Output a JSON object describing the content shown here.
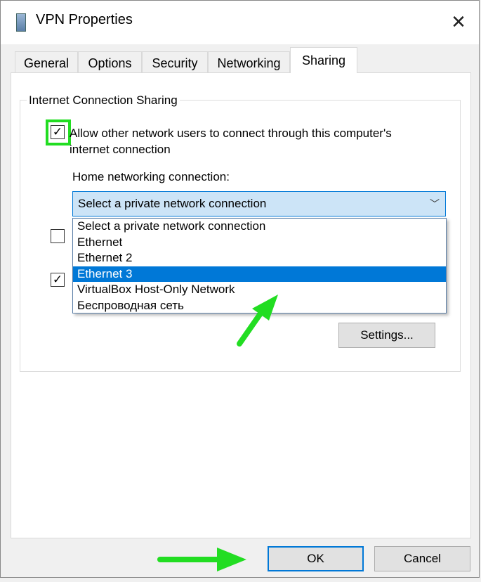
{
  "window": {
    "title": "VPN Properties",
    "icon": "network-connection-icon",
    "close_icon": "close-icon"
  },
  "tabs": [
    {
      "label": "General"
    },
    {
      "label": "Options"
    },
    {
      "label": "Security"
    },
    {
      "label": "Networking"
    },
    {
      "label": "Sharing",
      "active": true
    }
  ],
  "sharing": {
    "group_label": "Internet Connection Sharing",
    "allow_checkbox": {
      "label": "Allow other network users to connect through this computer's internet connection",
      "checked": true
    },
    "home_label": "Home networking connection:",
    "combo_value": "Select a private network connection",
    "options": [
      "Select a private network connection",
      "Ethernet",
      "Ethernet 2",
      "Ethernet 3",
      "VirtualBox Host-Only Network",
      "Беспроводная сеть"
    ],
    "highlighted_option": "Ethernet 3",
    "checkbox2_checked": false,
    "checkbox3_checked": true,
    "settings_button": "Settings..."
  },
  "buttons": {
    "ok": "OK",
    "cancel": "Cancel"
  },
  "colors": {
    "accent": "#0078d7",
    "annotation": "#22dd22"
  }
}
